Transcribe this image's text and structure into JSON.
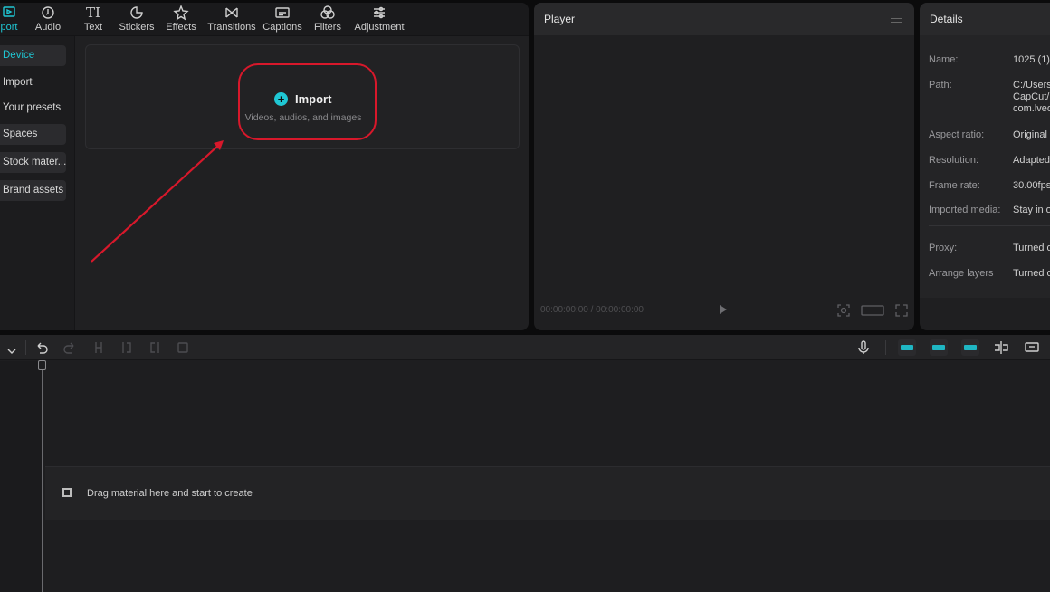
{
  "toolbar": {
    "tabs": [
      {
        "label": "port",
        "icon": "import-icon"
      },
      {
        "label": "Audio",
        "icon": "audio-icon"
      },
      {
        "label": "Text",
        "icon": "text-icon"
      },
      {
        "label": "Stickers",
        "icon": "stickers-icon"
      },
      {
        "label": "Effects",
        "icon": "effects-icon"
      },
      {
        "label": "Transitions",
        "icon": "transitions-icon"
      },
      {
        "label": "Captions",
        "icon": "captions-icon"
      },
      {
        "label": "Filters",
        "icon": "filters-icon"
      },
      {
        "label": "Adjustment",
        "icon": "adjustment-icon"
      }
    ],
    "text_glyph": "TI"
  },
  "sidebar": {
    "items": [
      {
        "label": "Device"
      },
      {
        "label": "Import"
      },
      {
        "label": "Your presets"
      },
      {
        "label": "Spaces"
      },
      {
        "label": "Stock mater..."
      },
      {
        "label": "Brand assets"
      }
    ]
  },
  "import": {
    "label": "Import",
    "subtitle": "Videos, audios, and images"
  },
  "player": {
    "title": "Player",
    "timecode": "00:00:00:00 / 00:00:00:00"
  },
  "details": {
    "title": "Details",
    "rows": [
      {
        "label": "Name:",
        "value": "1025 (1)"
      },
      {
        "label": "Path:",
        "value": "C:/Users/\nCapCut/\ncom.lveo"
      },
      {
        "label": "Aspect ratio:",
        "value": "Original"
      },
      {
        "label": "Resolution:",
        "value": "Adapted"
      },
      {
        "label": "Frame rate:",
        "value": "30.00fps"
      },
      {
        "label": "Imported media:",
        "value": "Stay in o"
      },
      {
        "label": "Proxy:",
        "value": "Turned o"
      },
      {
        "label": "Arrange layers",
        "value": "Turned o"
      }
    ]
  },
  "timeline": {
    "drag_hint": "Drag material here and start to create"
  },
  "colors": {
    "accent": "#1fc7d4",
    "highlight": "#d8182b"
  }
}
